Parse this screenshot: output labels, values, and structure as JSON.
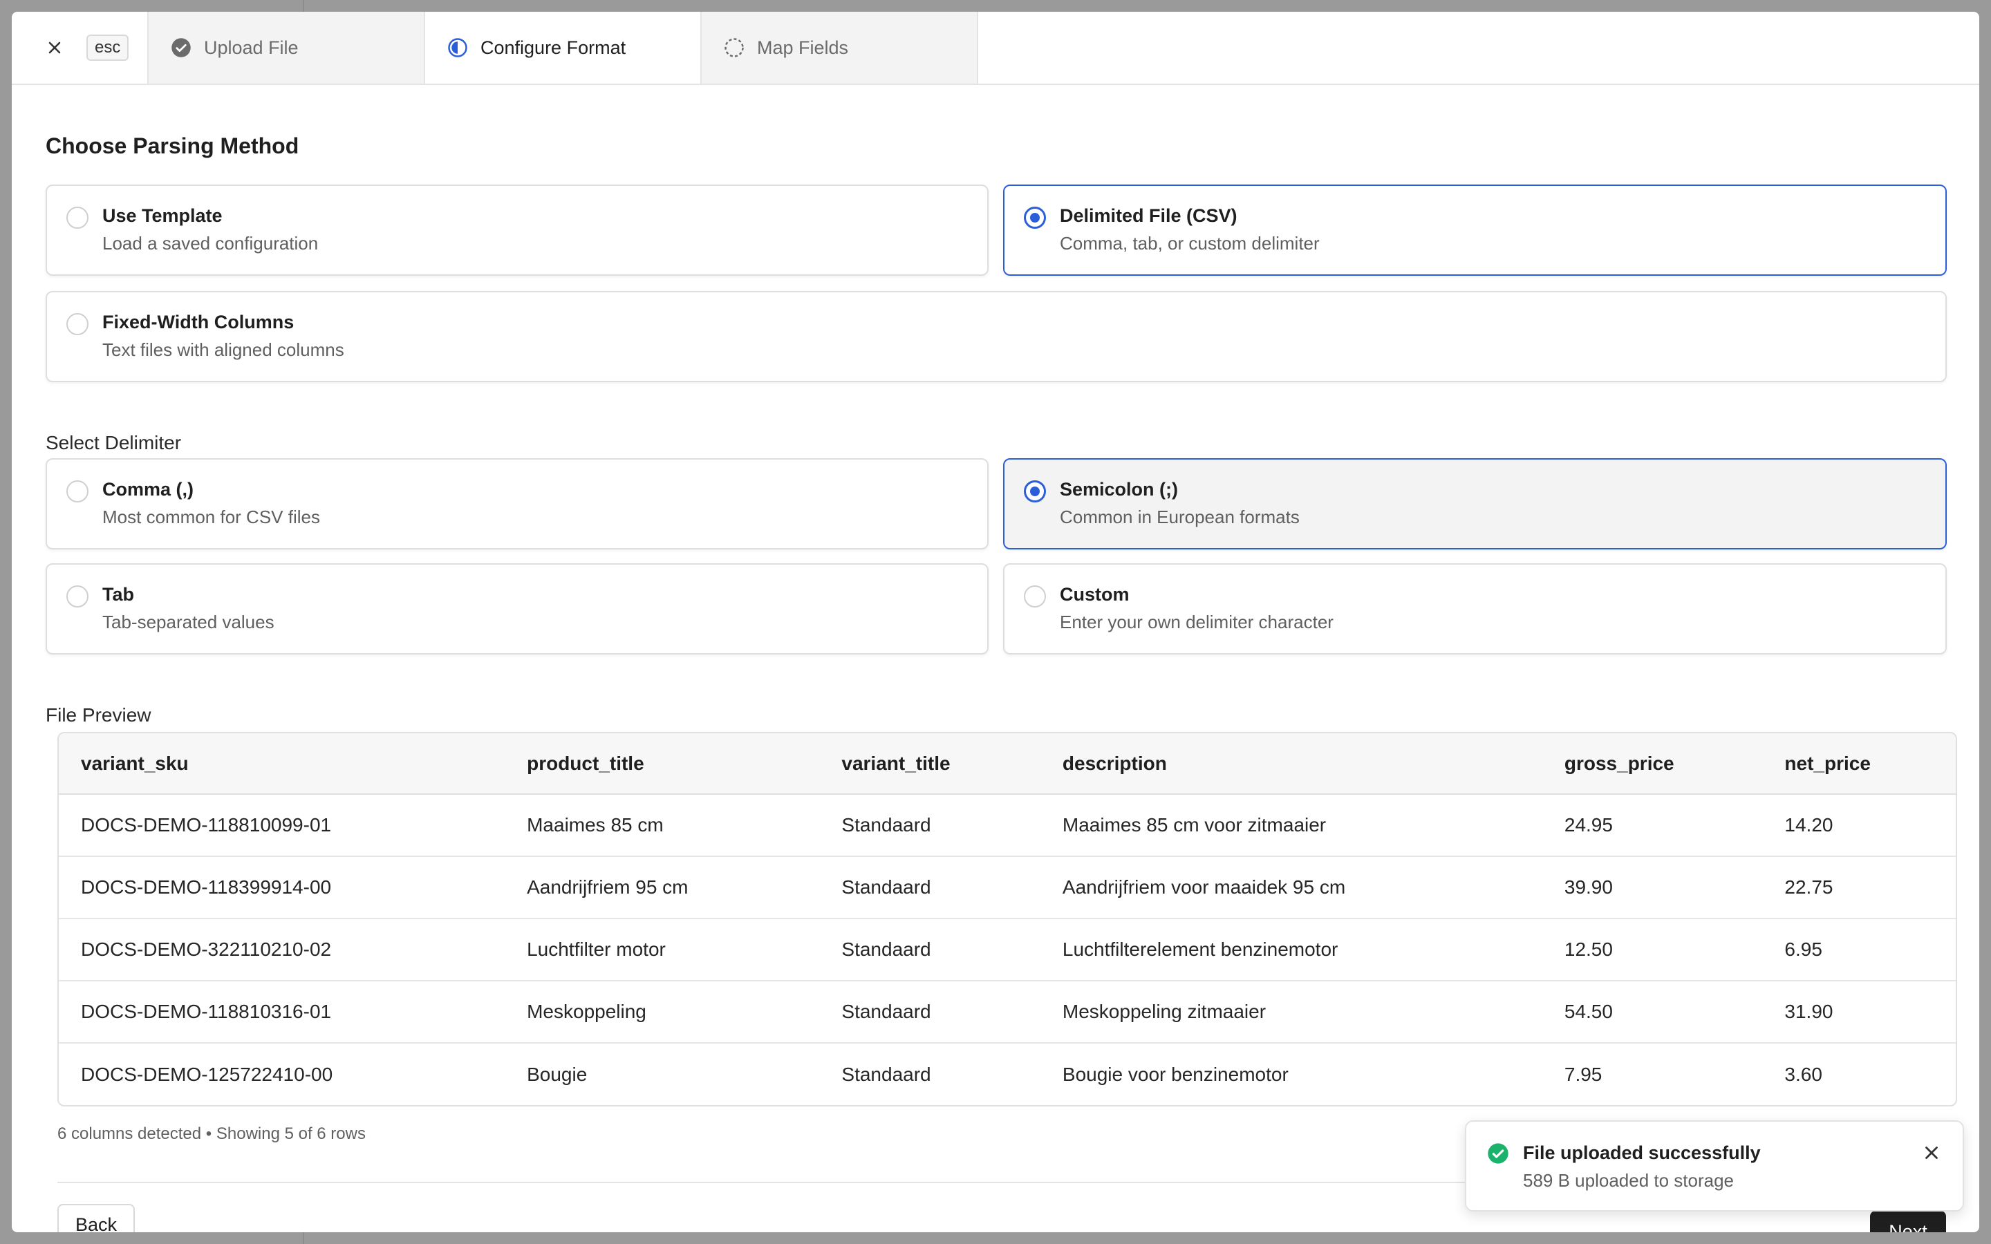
{
  "header": {
    "close_icon": "close-icon",
    "esc_label": "esc",
    "steps": [
      {
        "label": "Upload File",
        "icon": "check-circle-icon",
        "state": "complete"
      },
      {
        "label": "Configure Format",
        "icon": "half-circle-icon",
        "state": "current"
      },
      {
        "label": "Map Fields",
        "icon": "dashed-circle-icon",
        "state": "upcoming"
      }
    ]
  },
  "parsing": {
    "title": "Choose Parsing Method",
    "options": [
      {
        "title": "Use Template",
        "description": "Load a saved configuration",
        "selected": false
      },
      {
        "title": "Delimited File (CSV)",
        "description": "Comma, tab, or custom delimiter",
        "selected": true
      },
      {
        "title": "Fixed-Width Columns",
        "description": "Text files with aligned columns",
        "selected": false
      }
    ]
  },
  "delimiter": {
    "label": "Select Delimiter",
    "options": [
      {
        "title": "Comma (,)",
        "description": "Most common for CSV files",
        "selected": false
      },
      {
        "title": "Semicolon (;)",
        "description": "Common in European formats",
        "selected": true
      },
      {
        "title": "Tab",
        "description": "Tab-separated values",
        "selected": false
      },
      {
        "title": "Custom",
        "description": "Enter your own delimiter character",
        "selected": false
      }
    ]
  },
  "preview": {
    "label": "File Preview",
    "columns": [
      "variant_sku",
      "product_title",
      "variant_title",
      "description",
      "gross_price",
      "net_price"
    ],
    "rows": [
      [
        "DOCS-DEMO-118810099-01",
        "Maaimes 85 cm",
        "Standaard",
        "Maaimes 85 cm voor zitmaaier",
        "24.95",
        "14.20"
      ],
      [
        "DOCS-DEMO-118399914-00",
        "Aandrijfriem 95 cm",
        "Standaard",
        "Aandrijfriem voor maaidek 95 cm",
        "39.90",
        "22.75"
      ],
      [
        "DOCS-DEMO-322110210-02",
        "Luchtfilter motor",
        "Standaard",
        "Luchtfilterelement benzinemotor",
        "12.50",
        "6.95"
      ],
      [
        "DOCS-DEMO-118810316-01",
        "Meskoppeling",
        "Standaard",
        "Meskoppeling zitmaaier",
        "54.50",
        "31.90"
      ],
      [
        "DOCS-DEMO-125722410-00",
        "Bougie",
        "Standaard",
        "Bougie voor benzinemotor",
        "7.95",
        "3.60"
      ]
    ],
    "meta": "6 columns detected • Showing 5 of 6 rows"
  },
  "footer": {
    "back_label": "Back",
    "next_label": "Next"
  },
  "toast": {
    "icon": "check-circle-icon",
    "title": "File uploaded successfully",
    "description": "589 B uploaded to storage",
    "close_icon": "close-icon"
  },
  "colors": {
    "accent": "#2b5fd9",
    "success": "#1bb36b",
    "overlay": "#9a9a9a"
  }
}
